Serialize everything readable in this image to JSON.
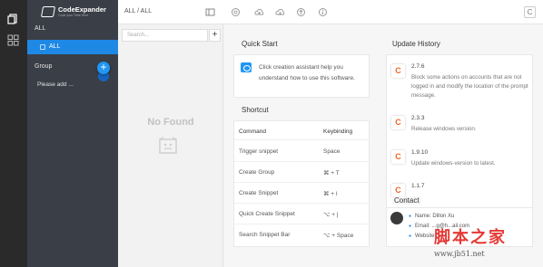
{
  "app": {
    "logo_title": "CodeExpander",
    "logo_subtitle": "Code your Time Here"
  },
  "sidebar": {
    "all_header": "ALL",
    "active_item": "ALL",
    "group_header": "Group",
    "placeholder_item": "Please add ...",
    "add_group_icon": "plus-icon"
  },
  "topbar": {
    "breadcrumb": "ALL / ALL",
    "icons": [
      "panel-icon",
      "help-icon",
      "cloud-upload-icon",
      "cloud-download-icon",
      "arrow-up-circle-icon",
      "info-circle-icon",
      "logo-button-icon"
    ],
    "right_button_label": "C"
  },
  "list": {
    "search_placeholder": "Search...",
    "add_label": "+",
    "empty_text": "No Found"
  },
  "quick_start": {
    "title": "Quick Start",
    "text": "Click creation assistant help you understand how to use this software."
  },
  "shortcut": {
    "title": "Shortcut",
    "col_command": "Command",
    "col_keybinding": "Keybinding",
    "rows": [
      {
        "command": "Trigger snippet",
        "key": "Space"
      },
      {
        "command": "Create Group",
        "key": "⌘ + T"
      },
      {
        "command": "Create Snippet",
        "key": "⌘ + I"
      },
      {
        "command": "Quick Create Snippet",
        "key": "⌥ + |"
      },
      {
        "command": "Search Snippet Bar",
        "key": "⌥ + Space"
      }
    ]
  },
  "update_history": {
    "title": "Update History",
    "items": [
      {
        "version": "2.7.6",
        "desc": "Block some actions on accounts that are not logged in and modify the location of the prompt message."
      },
      {
        "version": "2.3.3",
        "desc": "Release windows version."
      },
      {
        "version": "1.9.10",
        "desc": "Update windows-version to latest."
      },
      {
        "version": "1.1.7",
        "desc": ""
      }
    ],
    "logo_letter": "C"
  },
  "contact": {
    "title": "Contact",
    "name": "Name: Dillon Xu",
    "email": "Email: ...g@h...ail.com",
    "website": "Website: ..."
  },
  "watermark": {
    "text": "脚本之家",
    "url": "www.jb51.net"
  },
  "colors": {
    "accent": "#1e88e5",
    "sidebar_bg": "#3a3e47",
    "rail_bg": "#2a2a2a",
    "logo_orange": "#f26522",
    "watermark_red": "#e53935"
  }
}
